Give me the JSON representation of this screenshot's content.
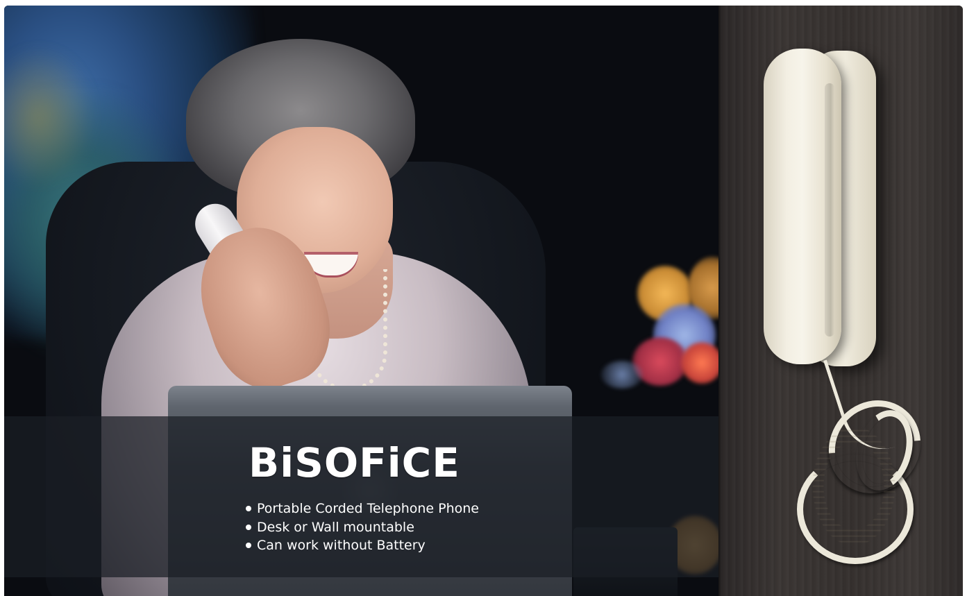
{
  "banner": {
    "brand": "BiSOFiCE",
    "features": [
      "Portable Corded Telephone Phone",
      "Desk or Wall mountable",
      "Can work without Battery"
    ]
  },
  "colors": {
    "caption_band": "#1a1e26",
    "text": "#ffffff",
    "phone": "#efebdd",
    "wood_panel": "#35302e"
  }
}
